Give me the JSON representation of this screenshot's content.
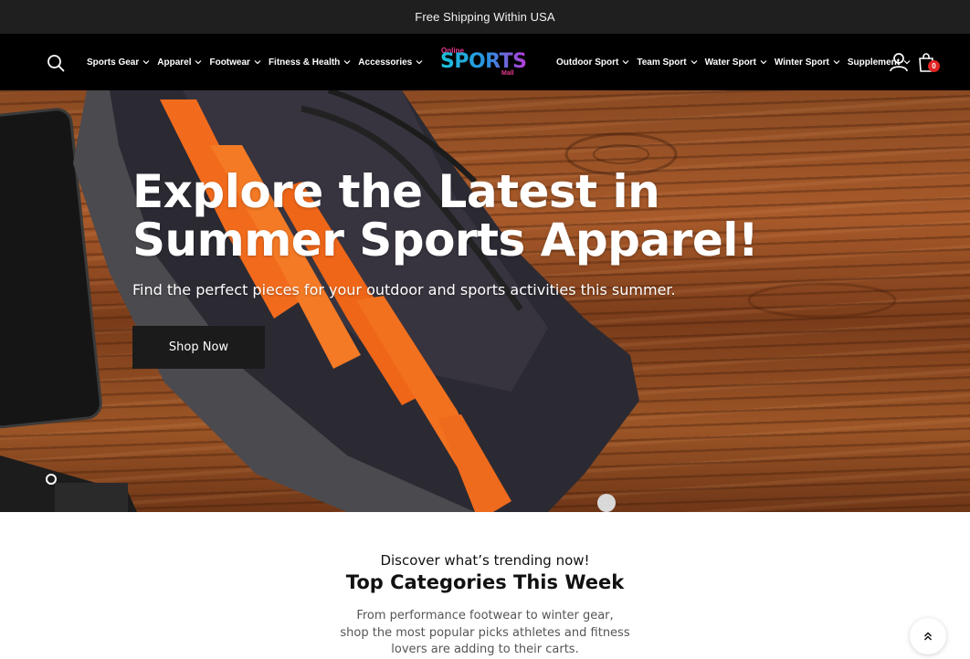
{
  "announcement": {
    "text": "Free Shipping Within USA"
  },
  "header": {
    "nav_left": [
      {
        "label": "Sports Gear"
      },
      {
        "label": "Apparel"
      },
      {
        "label": "Footwear"
      },
      {
        "label": "Fitness & Health"
      },
      {
        "label": "Accessories"
      }
    ],
    "nav_right": [
      {
        "label": "Outdoor Sport"
      },
      {
        "label": "Team Sport"
      },
      {
        "label": "Water Sport"
      },
      {
        "label": "Winter Sport"
      },
      {
        "label": "Supplement"
      }
    ],
    "logo": {
      "top_text": "Online",
      "main_text": "SPORTS",
      "bottom_text": "Mall"
    },
    "cart_count": "0",
    "icons": {
      "search": "search-icon",
      "user": "user-icon",
      "cart": "shopping-bag-icon",
      "chevron": "chevron-down-icon"
    }
  },
  "hero": {
    "title_line1": "Explore the Latest in",
    "title_line2": "Summer Sports Apparel!",
    "subtitle": "Find the perfect pieces for your outdoor and sports activities this summer.",
    "cta_label": "Shop Now"
  },
  "trending": {
    "eyebrow": "Discover what’s trending now!",
    "title": "Top Categories This Week",
    "desc_line1": "From performance footwear to winter gear,",
    "desc_line2": "shop the most popular picks athletes and fitness",
    "desc_line3": "lovers are adding to their carts."
  },
  "colors": {
    "header_bg": "#000000",
    "announce_bg": "#1f1f1f",
    "cart_badge": "#e02424",
    "button_bg": "#1b1b1b"
  }
}
